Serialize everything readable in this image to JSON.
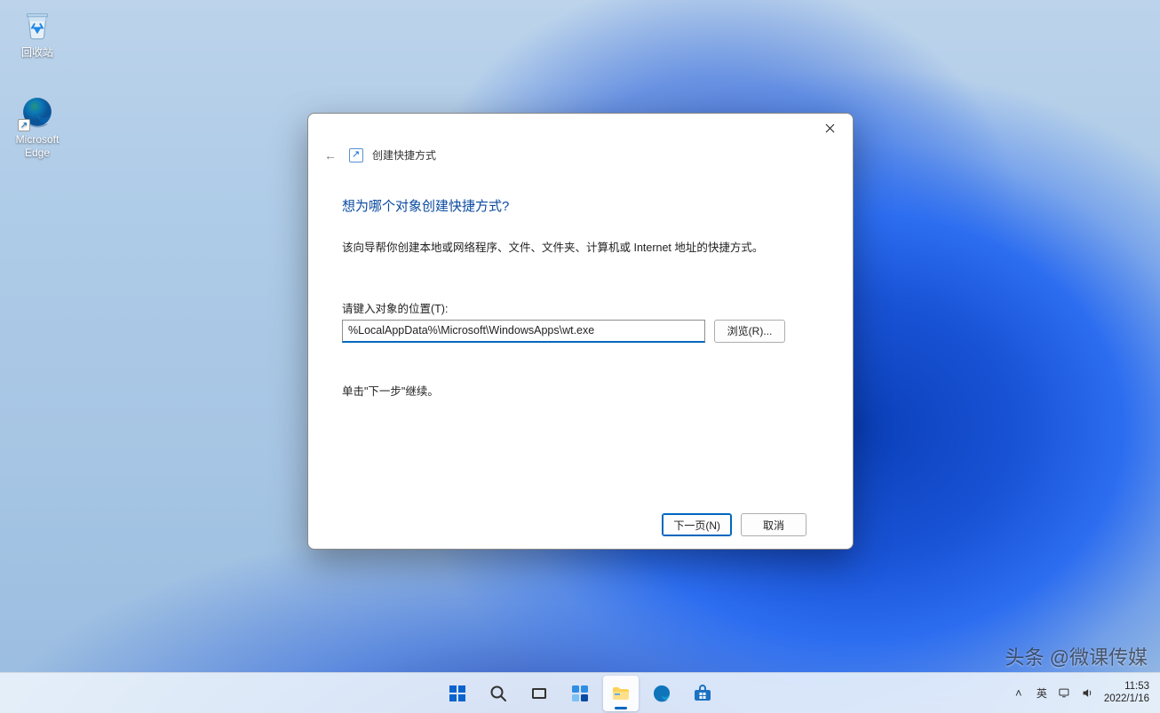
{
  "desktop": {
    "icons": {
      "recycle_bin": "回收站",
      "edge": "Microsoft\nEdge"
    }
  },
  "dialog": {
    "title_crumb": "创建快捷方式",
    "heading": "想为哪个对象创建快捷方式?",
    "description": "该向导帮你创建本地或网络程序、文件、文件夹、计算机或 Internet 地址的快捷方式。",
    "location_label": "请键入对象的位置(T):",
    "location_value": "%LocalAppData%\\Microsoft\\WindowsApps\\wt.exe",
    "browse": "浏览(R)...",
    "continue_hint": "单击\"下一步\"继续。",
    "next": "下一页(N)",
    "cancel": "取消"
  },
  "systray": {
    "chevron": "˄",
    "ime": "英",
    "time": "11:53",
    "date": "2022/1/16"
  },
  "watermark": "头条 @微课传媒"
}
